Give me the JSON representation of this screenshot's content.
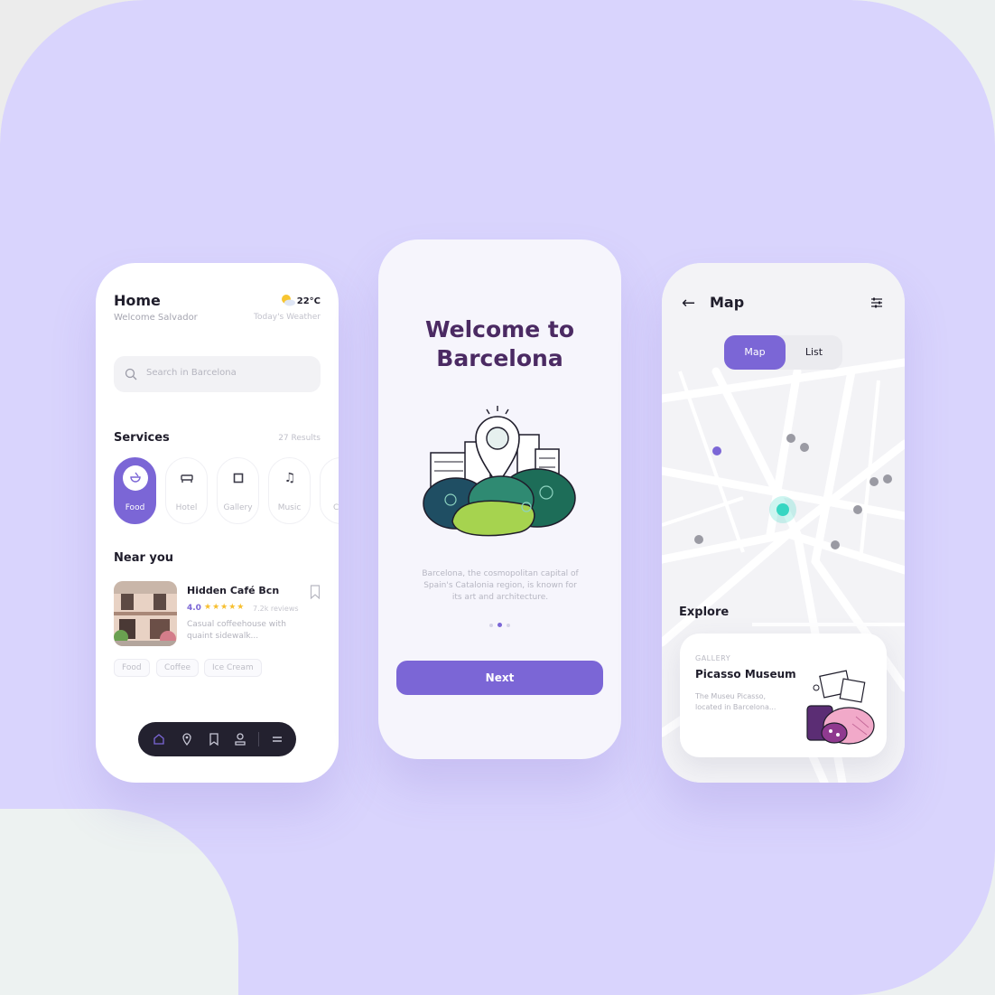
{
  "home": {
    "title": "Home",
    "subtitle": "Welcome Salvador",
    "weather_temp": "22°C",
    "weather_label": "Today's Weather",
    "search_placeholder": "Search in Barcelona",
    "services_title": "Services",
    "services_count": "27 Results",
    "services": [
      {
        "label": "Food",
        "icon": "food-bowl-icon",
        "active": true
      },
      {
        "label": "Hotel",
        "icon": "bed-icon",
        "active": false
      },
      {
        "label": "Gallery",
        "icon": "frame-icon",
        "active": false
      },
      {
        "label": "Music",
        "icon": "music-note-icon",
        "active": false
      }
    ],
    "near_title": "Near you",
    "place": {
      "name": "Hidden Café Bcn",
      "rating": "4.0",
      "stars": "★★★★★",
      "reviews": "7.2k reviews",
      "description": "Casual coffeehouse with quaint sidewalk..."
    },
    "tags": [
      "Food",
      "Coffee",
      "Ice Cream"
    ],
    "nav_icons": [
      "home-icon",
      "location-pin-icon",
      "bookmark-icon",
      "user-icon",
      "menu-icon"
    ]
  },
  "welcome": {
    "title_line1": "Welcome to",
    "title_line2": "Barcelona",
    "description": "Barcelona, the cosmopolitan capital of Spain's Catalonia region, is known for its art and architecture.",
    "page_index": 2,
    "page_count": 3,
    "next_label": "Next"
  },
  "map": {
    "back": "←",
    "title": "Map",
    "toggle_map": "Map",
    "toggle_list": "List",
    "explore_title": "Explore",
    "card": {
      "category": "GALLERY",
      "name": "Picasso Museum",
      "description": "The Museu Picasso, located in Barcelona..."
    }
  },
  "colors": {
    "accent": "#7b66d6",
    "background": "#d9d4fd",
    "title_dark": "#4b2a63",
    "teal_marker": "#37d6c2"
  }
}
